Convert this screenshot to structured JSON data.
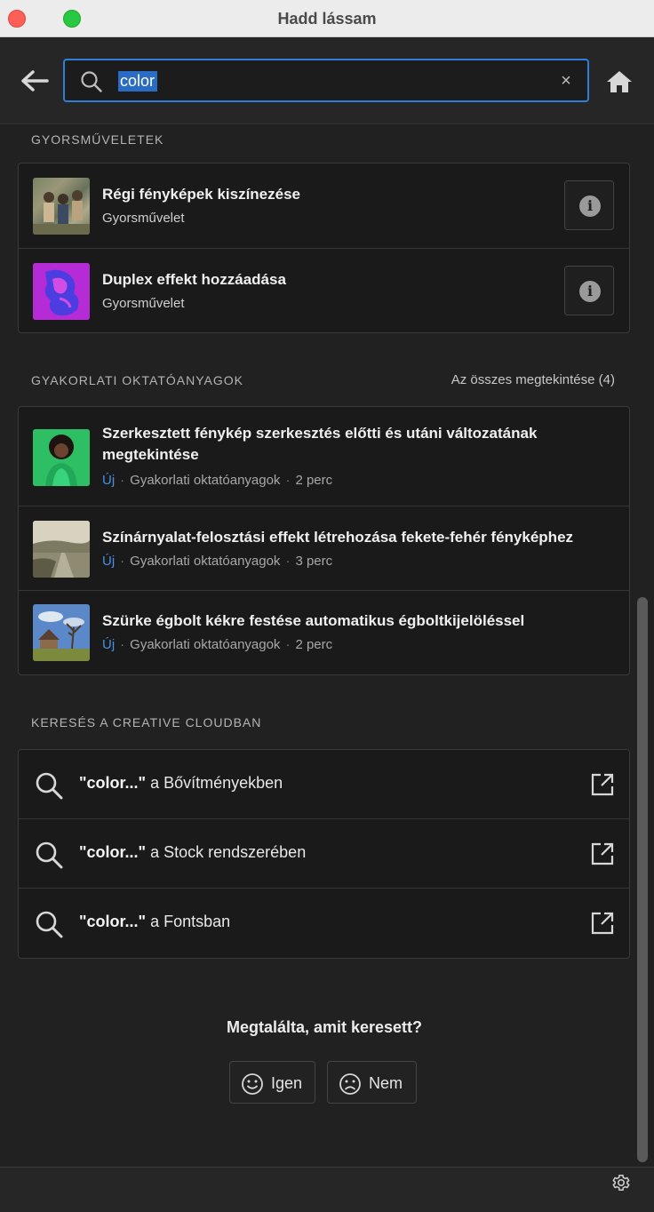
{
  "window": {
    "title": "Hadd lássam"
  },
  "search": {
    "query": "color",
    "clear_label": "×"
  },
  "quick_actions": {
    "section_title": "GYORSMŰVELETEK",
    "items": [
      {
        "title": "Régi fényképek kiszínezése",
        "subtitle": "Gyorsművelet"
      },
      {
        "title": "Duplex effekt hozzáadása",
        "subtitle": "Gyorsművelet"
      }
    ]
  },
  "tutorials": {
    "section_title": "GYAKORLATI OKTATÓANYAGOK",
    "see_all": "Az összes megtekintése (4)",
    "items": [
      {
        "title_line1": "Szerkesztett fénykép szerkesztés előtti és utáni változatának",
        "title_line2": "megtekintése",
        "tag": "Új",
        "category": "Gyakorlati oktatóanyagok",
        "duration": "2 perc"
      },
      {
        "title": "Színárnyalat-felosztási effekt létrehozása fekete-fehér fényképhez",
        "tag": "Új",
        "category": "Gyakorlati oktatóanyagok",
        "duration": "3 perc"
      },
      {
        "title": "Szürke égbolt kékre festése automatikus égboltkijelöléssel",
        "tag": "Új",
        "category": "Gyakorlati oktatóanyagok",
        "duration": "2 perc"
      }
    ]
  },
  "creative_cloud": {
    "section_title": "KERESÉS A CREATIVE CLOUDBAN",
    "items": [
      {
        "query": "\"color...\"",
        "suffix": " a Bővítményekben"
      },
      {
        "query": "\"color...\"",
        "suffix": " a Stock rendszerében"
      },
      {
        "query": "\"color...\"",
        "suffix": " a Fontsban"
      }
    ]
  },
  "feedback": {
    "question": "Megtalálta, amit keresett?",
    "yes_label": "Igen",
    "no_label": "Nem"
  },
  "colors": {
    "accent": "#2f7fd8",
    "new_tag": "#4a90e2",
    "background": "#212121"
  }
}
